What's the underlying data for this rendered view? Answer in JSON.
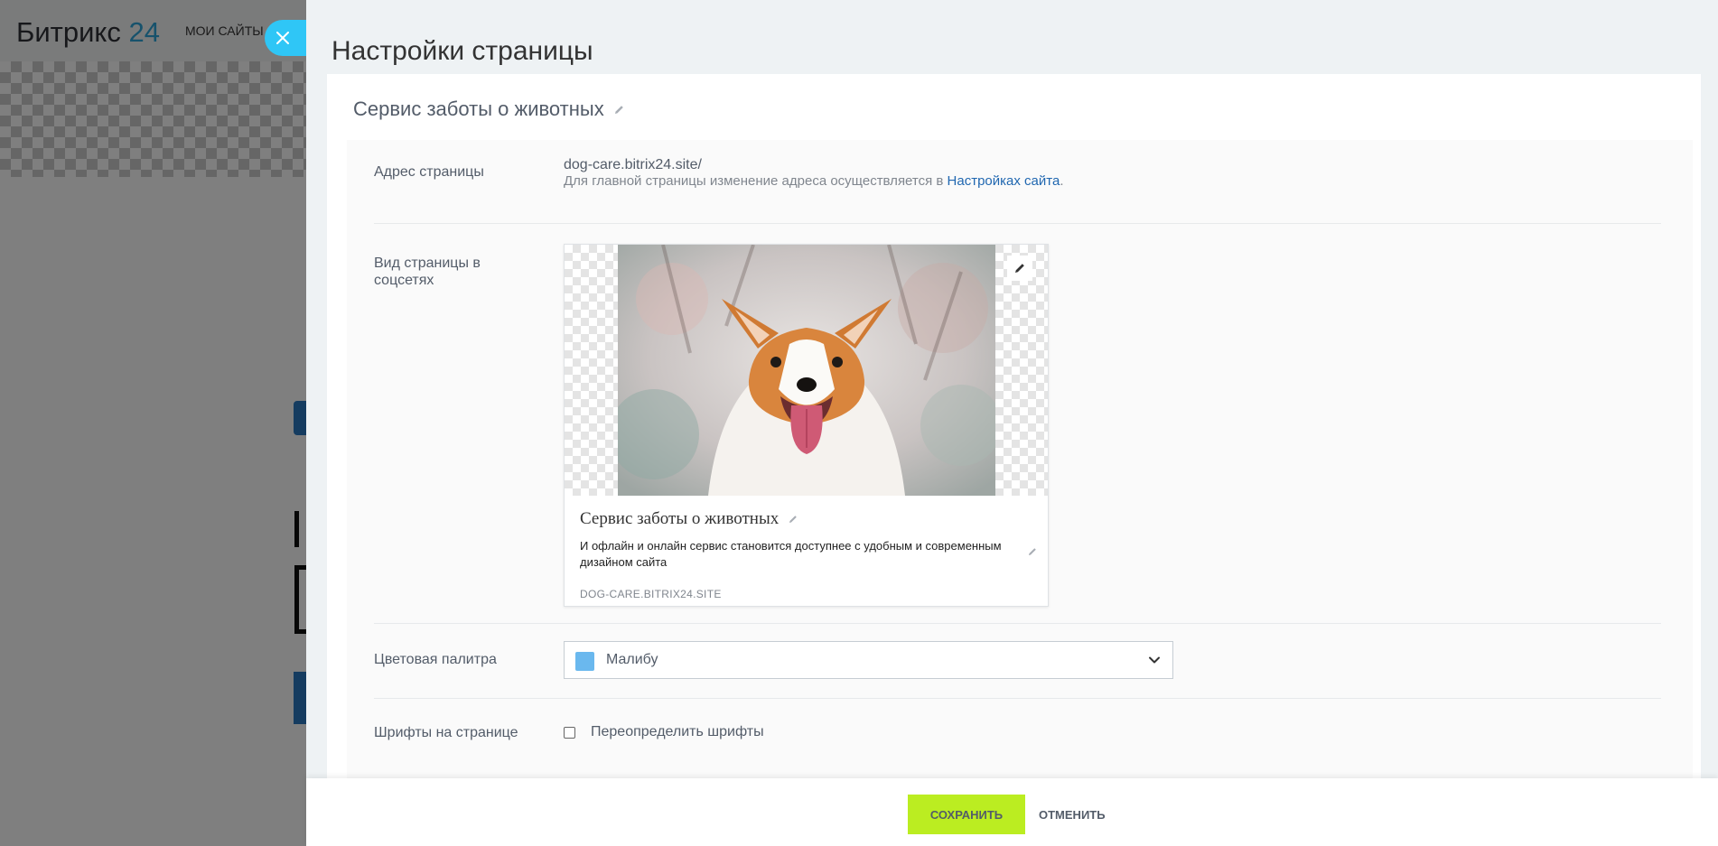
{
  "background_app": {
    "logo_text": "Битрикс",
    "logo_number": "24",
    "nav_label": "МОИ САЙТЫ"
  },
  "slider": {
    "title": "Настройки страницы",
    "page_name": "Сервис заботы о животных",
    "close_icon": "close-icon"
  },
  "address": {
    "label": "Адрес страницы",
    "value": "dog-care.bitrix24.site/",
    "hint_prefix": "Для главной страницы изменение адреса осуществляется в ",
    "hint_link": "Настройках сайта",
    "hint_suffix": "."
  },
  "social_preview": {
    "label": "Вид страницы в соцсетях",
    "title": "Сервис заботы о животных",
    "description": "И офлайн и онлайн сервис становится доступнее с удобным и современным дизайном сайта",
    "domain": "DOG-CARE.BITRIX24.SITE"
  },
  "palette": {
    "label": "Цветовая палитра",
    "value": "Малибу",
    "swatch_color": "#6ab8ee"
  },
  "fonts": {
    "label": "Шрифты на странице",
    "checkbox_label": "Переопределить шрифты",
    "checked": false
  },
  "footer": {
    "save_label": "СОХРАНИТЬ",
    "cancel_label": "ОТМЕНИТЬ",
    "save_color": "#bbed21"
  }
}
